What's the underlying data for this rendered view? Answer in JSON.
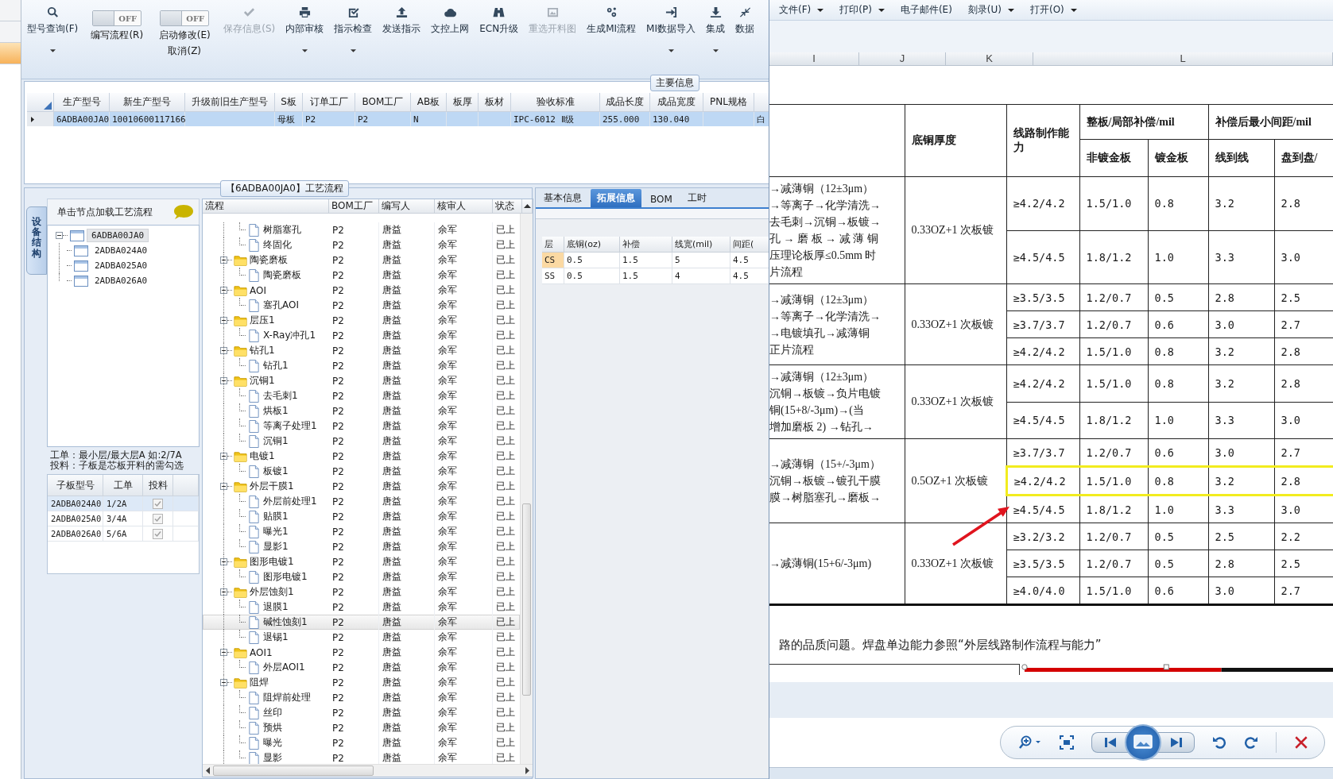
{
  "toolbar": [
    {
      "kind": "button",
      "label": "型号查询(F)",
      "dropdown": true,
      "disabled": false
    },
    {
      "kind": "toggle",
      "label": "编写流程(R)",
      "state_label": "OFF",
      "on": false
    },
    {
      "kind": "toggle",
      "label": "启动修改(E)",
      "label_2": "取消(Z)",
      "state_label": "OFF",
      "on": false
    },
    {
      "kind": "button",
      "label": "保存信息(S)",
      "dropdown": false,
      "disabled": true
    },
    {
      "kind": "button",
      "label": "内部审核",
      "dropdown": true,
      "disabled": false
    },
    {
      "kind": "button",
      "label": "指示检查",
      "dropdown": true,
      "disabled": false
    },
    {
      "kind": "button",
      "label": "发送指示",
      "dropdown": false,
      "disabled": false
    },
    {
      "kind": "button",
      "label": "文控上网",
      "dropdown": false,
      "disabled": false
    },
    {
      "kind": "button",
      "label": "ECN升级",
      "dropdown": false,
      "disabled": false
    },
    {
      "kind": "button",
      "label": "重选开料图",
      "dropdown": false,
      "disabled": true
    },
    {
      "kind": "button",
      "label": "生成MI流程",
      "dropdown": false,
      "disabled": false
    },
    {
      "kind": "button",
      "label": "MI数据导入",
      "dropdown": true,
      "disabled": false
    },
    {
      "kind": "button",
      "label": "集成",
      "dropdown": true,
      "disabled": false
    },
    {
      "kind": "button",
      "label": "数据",
      "dropdown": false,
      "disabled": false
    }
  ],
  "main_info": {
    "title": "主要信息",
    "columns": [
      "生产型号",
      "新生产型号",
      "升级前旧生产型号",
      "S板",
      "订单工厂",
      "BOM工厂",
      "AB板",
      "板厚",
      "板材",
      "验收标准",
      "成品长度",
      "成品宽度",
      "PNL规格"
    ],
    "rows": [
      {
        "selected": true,
        "cells": [
          "6ADBA00JA0",
          "10010600117166",
          null,
          "母板",
          "P2",
          "P2",
          "N",
          null,
          null,
          "IPC-6012 Ⅱ级",
          "255.000",
          "130.040",
          null,
          "白"
        ]
      }
    ]
  },
  "process_panel": {
    "title": "【6ADBA00JA0】工艺流程",
    "structure_tab": "设备结构",
    "hint": "单击节点加载工艺流程",
    "tree": [
      {
        "label": "6ADBA00JA0",
        "selected": true,
        "expanded": true,
        "children": [
          {
            "label": "2ADBA024A0",
            "selected": false
          },
          {
            "label": "2ADBA025A0",
            "selected": false
          },
          {
            "label": "2ADBA026A0",
            "selected": false
          }
        ]
      }
    ],
    "note_lines": [
      "工单：最小层/最大层A 如:2/7A",
      "投料：子板是芯板开料的需勾选"
    ],
    "sub_boards": {
      "columns": [
        "子板型号",
        "工单",
        "投料"
      ],
      "rows": [
        {
          "model": "2ADBA024A0",
          "order": "1/2A",
          "feed": true,
          "selected": true
        },
        {
          "model": "2ADBA025A0",
          "order": "3/4A",
          "feed": true,
          "selected": false
        },
        {
          "model": "2ADBA026A0",
          "order": "5/6A",
          "feed": true,
          "selected": false
        }
      ]
    }
  },
  "flow": {
    "columns": [
      "流程",
      "BOM工厂",
      "编写人",
      "核审人",
      "状态"
    ],
    "items": [
      {
        "children": [
          {
            "label": "树脂塞孔",
            "factory": "P2",
            "author": "唐益",
            "reviewer": "余军",
            "status": "已上",
            "selected": false
          },
          {
            "label": "终固化",
            "factory": "P2",
            "author": "唐益",
            "reviewer": "余军",
            "status": "已上",
            "selected": false
          }
        ]
      },
      {
        "label": "陶瓷磨板",
        "factory": "P2",
        "author": "唐益",
        "reviewer": "余军",
        "status": "已上",
        "selected": false,
        "expanded": true,
        "children": [
          {
            "label": "陶瓷磨板",
            "factory": "P2",
            "author": "唐益",
            "reviewer": "余军",
            "status": "已上",
            "selected": false
          }
        ]
      },
      {
        "label": "AOI",
        "factory": "P2",
        "author": "唐益",
        "reviewer": "余军",
        "status": "已上",
        "selected": false,
        "expanded": true,
        "children": [
          {
            "label": "塞孔AOI",
            "factory": "P2",
            "author": "唐益",
            "reviewer": "余军",
            "status": "已上",
            "selected": false
          }
        ]
      },
      {
        "label": "层压1",
        "factory": "P2",
        "author": "唐益",
        "reviewer": "余军",
        "status": "已上",
        "selected": false,
        "expanded": true,
        "children": [
          {
            "label": "X-Ray冲孔1",
            "factory": "P2",
            "author": "唐益",
            "reviewer": "余军",
            "status": "已上",
            "selected": false
          }
        ]
      },
      {
        "label": "钻孔1",
        "factory": "P2",
        "author": "唐益",
        "reviewer": "余军",
        "status": "已上",
        "selected": false,
        "expanded": true,
        "children": [
          {
            "label": "钻孔1",
            "factory": "P2",
            "author": "唐益",
            "reviewer": "余军",
            "status": "已上",
            "selected": false
          }
        ]
      },
      {
        "label": "沉铜1",
        "factory": "P2",
        "author": "唐益",
        "reviewer": "余军",
        "status": "已上",
        "selected": false,
        "expanded": true,
        "children": [
          {
            "label": "去毛刺1",
            "factory": "P2",
            "author": "唐益",
            "reviewer": "余军",
            "status": "已上",
            "selected": false
          },
          {
            "label": "烘板1",
            "factory": "P2",
            "author": "唐益",
            "reviewer": "余军",
            "status": "已上",
            "selected": false
          },
          {
            "label": "等离子处理1",
            "factory": "P2",
            "author": "唐益",
            "reviewer": "余军",
            "status": "已上",
            "selected": false
          },
          {
            "label": "沉铜1",
            "factory": "P2",
            "author": "唐益",
            "reviewer": "余军",
            "status": "已上",
            "selected": false
          }
        ]
      },
      {
        "label": "电镀1",
        "factory": "P2",
        "author": "唐益",
        "reviewer": "余军",
        "status": "已上",
        "selected": false,
        "expanded": true,
        "children": [
          {
            "label": "板镀1",
            "factory": "P2",
            "author": "唐益",
            "reviewer": "余军",
            "status": "已上",
            "selected": false
          }
        ]
      },
      {
        "label": "外层干膜1",
        "factory": "P2",
        "author": "唐益",
        "reviewer": "余军",
        "status": "已上",
        "selected": false,
        "expanded": true,
        "children": [
          {
            "label": "外层前处理1",
            "factory": "P2",
            "author": "唐益",
            "reviewer": "余军",
            "status": "已上",
            "selected": false
          },
          {
            "label": "贴膜1",
            "factory": "P2",
            "author": "唐益",
            "reviewer": "余军",
            "status": "已上",
            "selected": false
          },
          {
            "label": "曝光1",
            "factory": "P2",
            "author": "唐益",
            "reviewer": "余军",
            "status": "已上",
            "selected": false
          },
          {
            "label": "显影1",
            "factory": "P2",
            "author": "唐益",
            "reviewer": "余军",
            "status": "已上",
            "selected": false
          }
        ]
      },
      {
        "label": "图形电镀1",
        "factory": "P2",
        "author": "唐益",
        "reviewer": "余军",
        "status": "已上",
        "selected": false,
        "expanded": true,
        "children": [
          {
            "label": "图形电镀1",
            "factory": "P2",
            "author": "唐益",
            "reviewer": "余军",
            "status": "已上",
            "selected": false
          }
        ]
      },
      {
        "label": "外层蚀刻1",
        "factory": "P2",
        "author": "唐益",
        "reviewer": "余军",
        "status": "已上",
        "selected": false,
        "expanded": true,
        "children": [
          {
            "label": "退膜1",
            "factory": "P2",
            "author": "唐益",
            "reviewer": "余军",
            "status": "已上",
            "selected": false
          },
          {
            "label": "碱性蚀刻1",
            "factory": "P2",
            "author": "唐益",
            "reviewer": "余军",
            "status": "已上",
            "selected": true
          },
          {
            "label": "退锡1",
            "factory": "P2",
            "author": "唐益",
            "reviewer": "余军",
            "status": "已上",
            "selected": false
          }
        ]
      },
      {
        "label": "AOI1",
        "factory": "P2",
        "author": "唐益",
        "reviewer": "余军",
        "status": "已上",
        "selected": false,
        "expanded": true,
        "children": [
          {
            "label": "外层AOI1",
            "factory": "P2",
            "author": "唐益",
            "reviewer": "余军",
            "status": "已上",
            "selected": false
          }
        ]
      },
      {
        "label": "阻焊",
        "factory": "P2",
        "author": "唐益",
        "reviewer": "余军",
        "status": "已上",
        "selected": false,
        "expanded": true,
        "children": [
          {
            "label": "阻焊前处理",
            "factory": "P2",
            "author": "唐益",
            "reviewer": "余军",
            "status": "已上",
            "selected": false
          },
          {
            "label": "丝印",
            "factory": "P2",
            "author": "唐益",
            "reviewer": "余军",
            "status": "已上",
            "selected": false
          },
          {
            "label": "预烘",
            "factory": "P2",
            "author": "唐益",
            "reviewer": "余军",
            "status": "已上",
            "selected": false
          },
          {
            "label": "曝光",
            "factory": "P2",
            "author": "唐益",
            "reviewer": "余军",
            "status": "已上",
            "selected": false
          },
          {
            "label": "显影",
            "factory": "P2",
            "author": "唐益",
            "reviewer": "余军",
            "status": "已上",
            "selected": false
          }
        ]
      }
    ]
  },
  "detail": {
    "tabs": [
      {
        "label": "基本信息",
        "selected": false
      },
      {
        "label": "拓展信息",
        "selected": true
      },
      {
        "label": "BOM",
        "selected": false
      },
      {
        "label": "工时",
        "selected": false
      }
    ],
    "columns": [
      "层",
      "底铜(oz)",
      "补偿",
      "线宽(mil)",
      "间距("
    ],
    "rows": [
      {
        "cells": [
          "CS",
          "0.5",
          "1.5",
          "5",
          "4.5"
        ],
        "selected": true
      },
      {
        "cells": [
          "SS",
          "0.5",
          "1.5",
          "4",
          "4.5"
        ],
        "selected": false
      }
    ]
  },
  "viewer": {
    "menu": [
      {
        "label": "文件(F)",
        "dropdown": true
      },
      {
        "label": "打印(P)",
        "dropdown": true
      },
      {
        "label": "电子邮件(E)",
        "dropdown": false
      },
      {
        "label": "刻录(U)",
        "dropdown": true
      },
      {
        "label": "打开(O)",
        "dropdown": true
      }
    ],
    "document": {
      "sheet_columns": [
        "I",
        "J",
        "K",
        "L"
      ],
      "headers": {
        "base_copper": "底铜厚度",
        "capability": "线路制作能力",
        "compensation": "整板/局部补偿/mil",
        "non_gold": "非镀金板",
        "gold": "镀金板",
        "min_spacing": "补偿后最小间距/mil",
        "line_to_line": "线到线",
        "pad_to_pad": "盘到盘/"
      },
      "groups": [
        {
          "process_lines": [
            "→减薄铜（12±3μm）",
            "→等离子→化学清洗→",
            "去毛刺→沉铜→板镀→",
            "孔 → 磨 板 → 减 薄 铜",
            "压理论板厚≤0.5mm 时",
            "片流程"
          ],
          "base_copper": "0.33OZ+1 次板镀",
          "rows": [
            {
              "cells": [
                "≥4.2/4.2",
                "1.5/1.0",
                "0.8",
                "3.2",
                "2.8"
              ],
              "highlighted": false
            },
            {
              "cells": [
                "≥4.5/4.5",
                "1.8/1.2",
                "1.0",
                "3.3",
                "3.0"
              ],
              "highlighted": false
            }
          ]
        },
        {
          "process_lines": [
            "→减薄铜（12±3μm）",
            "→等离子→化学清洗→",
            "→电镀填孔→减薄铜",
            "正片流程"
          ],
          "base_copper": "0.33OZ+1 次板镀",
          "rows": [
            {
              "cells": [
                "≥3.5/3.5",
                "1.2/0.7",
                "0.5",
                "2.8",
                "2.5"
              ],
              "highlighted": false
            },
            {
              "cells": [
                "≥3.7/3.7",
                "1.2/0.7",
                "0.6",
                "3.0",
                "2.7"
              ],
              "highlighted": false
            },
            {
              "cells": [
                "≥4.2/4.2",
                "1.5/1.0",
                "0.8",
                "3.2",
                "2.8"
              ],
              "highlighted": false
            }
          ]
        },
        {
          "process_lines": [
            "→减薄铜（12±3μm）",
            "沉铜→板镀→负片电镀",
            "铜(15+8/-3μm)→(当",
            "增加磨板 2) →钻孔→"
          ],
          "base_copper": "0.33OZ+1 次板镀",
          "rows": [
            {
              "cells": [
                "≥4.2/4.2",
                "1.5/1.0",
                "0.8",
                "3.2",
                "2.8"
              ],
              "highlighted": false
            },
            {
              "cells": [
                "≥4.5/4.5",
                "1.8/1.2",
                "1.0",
                "3.3",
                "3.0"
              ],
              "highlighted": false
            }
          ]
        },
        {
          "process_lines": [
            "→减薄铜（15+/-3μm）",
            "沉铜→板镀→镀孔干膜",
            "膜→树脂塞孔→磨板→"
          ],
          "base_copper": "0.5OZ+1 次板镀",
          "rows": [
            {
              "cells": [
                "≥3.7/3.7",
                "1.2/0.7",
                "0.6",
                "3.0",
                "2.7"
              ],
              "highlighted": false
            },
            {
              "cells": [
                "≥4.2/4.2",
                "1.5/1.0",
                "0.8",
                "3.2",
                "2.8"
              ],
              "highlighted": true
            },
            {
              "cells": [
                "≥4.5/4.5",
                "1.8/1.2",
                "1.0",
                "3.3",
                "3.0"
              ],
              "highlighted": false
            }
          ]
        },
        {
          "process_lines": [
            "→减薄铜(15+6/-3μm)"
          ],
          "base_copper": "0.33OZ+1 次板镀",
          "rows": [
            {
              "cells": [
                "≥3.2/3.2",
                "1.2/0.7",
                "0.5",
                "2.5",
                "2.2"
              ],
              "highlighted": false
            },
            {
              "cells": [
                "≥3.5/3.5",
                "1.2/0.7",
                "0.5",
                "2.8",
                "2.5"
              ],
              "highlighted": false
            },
            {
              "cells": [
                "≥4.0/4.0",
                "1.5/1.0",
                "0.6",
                "3.0",
                "2.7"
              ],
              "highlighted": false
            }
          ]
        }
      ],
      "footnote": "路的品质问题。焊盘单边能力参照“外层线路制作流程与能力”"
    }
  }
}
